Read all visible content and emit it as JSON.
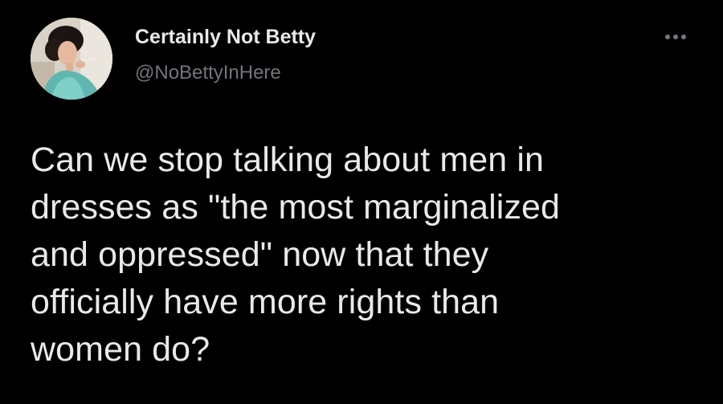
{
  "author": {
    "display_name": "Certainly Not Betty",
    "handle": "@NoBettyInHere",
    "avatar_icon": "profile-photo"
  },
  "menu": {
    "more_icon": "more-options-icon"
  },
  "tweet": {
    "text": "Can we stop talking about men in\ndresses as \"the most marginalized\nand oppressed\" now that they\nofficially have more rights than\nwomen do?"
  },
  "colors": {
    "background": "#000000",
    "primary_text": "#e7e9ea",
    "secondary_text": "#71767b"
  }
}
